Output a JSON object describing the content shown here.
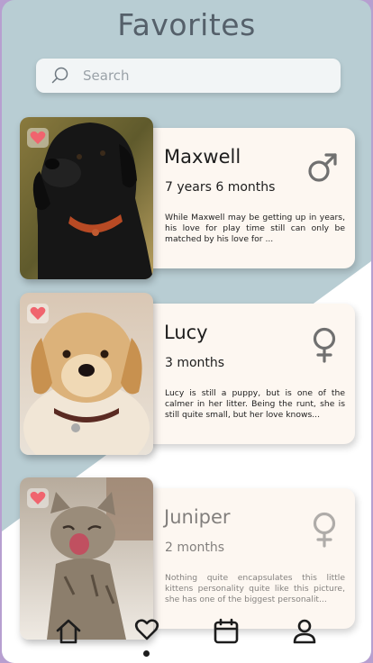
{
  "header": {
    "title": "Favorites"
  },
  "search": {
    "placeholder": "Search"
  },
  "pets": [
    {
      "name": "Maxwell",
      "age": "7 years 6 months",
      "description": "While Maxwell may be getting up in years, his love for play time still can only be matched by his love for ...",
      "gender": "male",
      "gender_icon": "male-symbol-icon",
      "favorite": true
    },
    {
      "name": "Lucy",
      "age": "3 months",
      "description": "Lucy is still a puppy, but is one of the calmer in her litter. Being the runt, she is still quite small, but her love knows...",
      "gender": "female",
      "gender_icon": "female-symbol-icon",
      "favorite": true
    },
    {
      "name": "Juniper",
      "age": "2 months",
      "description": "Nothing quite encapsulates this little kittens personality quite like this picture, she has one of the biggest personalit...",
      "gender": "female",
      "gender_icon": "female-symbol-icon",
      "favorite": true
    }
  ],
  "nav": [
    {
      "icon": "home-icon",
      "active": false
    },
    {
      "icon": "heart-icon",
      "active": true
    },
    {
      "icon": "calendar-icon",
      "active": false
    },
    {
      "icon": "profile-icon",
      "active": false
    }
  ],
  "colors": {
    "background_top": "#b8cdd3",
    "background_bottom": "#ffffff",
    "card": "#fdf7f1",
    "heart": "#f0646e",
    "text": "#1d1d1d",
    "gender_icon": "#707070"
  }
}
